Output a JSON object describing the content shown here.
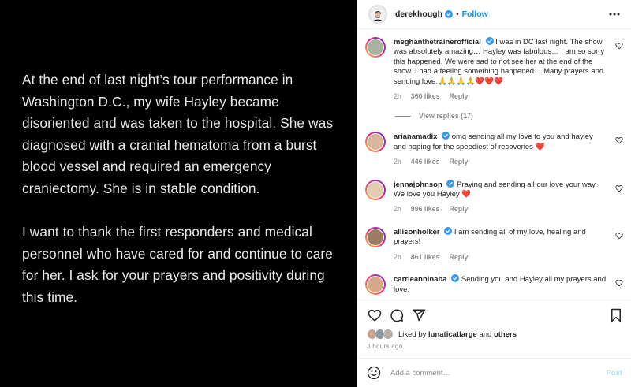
{
  "post": {
    "paragraph1": "At the end of last night’s tour performance in Washington D.C., my wife Hayley became disoriented and was taken to the hospital.  She was diagnosed with a cranial hematoma from a burst blood vessel and required an emergency craniectomy.  She is in stable condition.",
    "paragraph2": "I want to thank the first responders and medical personnel who have cared for and continue to care for her.  I ask for your prayers and positivity during this time."
  },
  "header": {
    "username": "derekhough",
    "separator": "•",
    "follow_label": "Follow"
  },
  "comments": [
    {
      "username": "meghanthetrainerofficial",
      "text": "I was in DC last night. The show was absolutely amazing… Hayley was fabulous… I am so sorry this happened. We were sad to not see her at the end of the show. I had a feeling something happened… Many prayers and sending love.",
      "emojis": "🙏🙏🙏🙏❤️❤️❤️",
      "time": "2h",
      "likes": "360 likes",
      "reply": "Reply",
      "view_replies": "View replies (17)",
      "avatar_color": "#a7b3a0"
    },
    {
      "username": "arianamadix",
      "text": "omg sending all my love to you and hayley and hoping for the speediest of recoveries",
      "emojis": "❤️",
      "time": "2h",
      "likes": "446 likes",
      "reply": "Reply",
      "avatar_color": "#d9b59b"
    },
    {
      "username": "jennajohnson",
      "text": "Praying and sending all our love your way. We love you Hayley",
      "emojis": "❤️",
      "time": "2h",
      "likes": "996 likes",
      "reply": "Reply",
      "avatar_color": "#e2cdb4"
    },
    {
      "username": "allisonholker",
      "text": "I am sending all of my love, healing and prayers!",
      "emojis": "",
      "time": "2h",
      "likes": "861 likes",
      "reply": "Reply",
      "avatar_color": "#9c7b63"
    },
    {
      "username": "carrieanninaba",
      "text": "Sending you and Hayley all my prayers and love.",
      "emojis": "",
      "time": "2h",
      "likes": "",
      "reply": "",
      "avatar_color": "#d7a98a"
    }
  ],
  "actions": {
    "liked_by_prefix": "Liked by",
    "liked_by_user": "lunaticatlarge",
    "liked_by_and": "and",
    "liked_by_others": "others",
    "time_ago": "3 hours ago",
    "liker_colors": [
      "#c9a38e",
      "#8f9aa3",
      "#b7b0a8"
    ]
  },
  "add_comment": {
    "placeholder": "Add a comment…",
    "post_label": "Post"
  },
  "colors": {
    "accent": "#0095f6",
    "verified": "#3897f0",
    "heart_red": "#ed4956",
    "muted": "#8e8e8e"
  }
}
